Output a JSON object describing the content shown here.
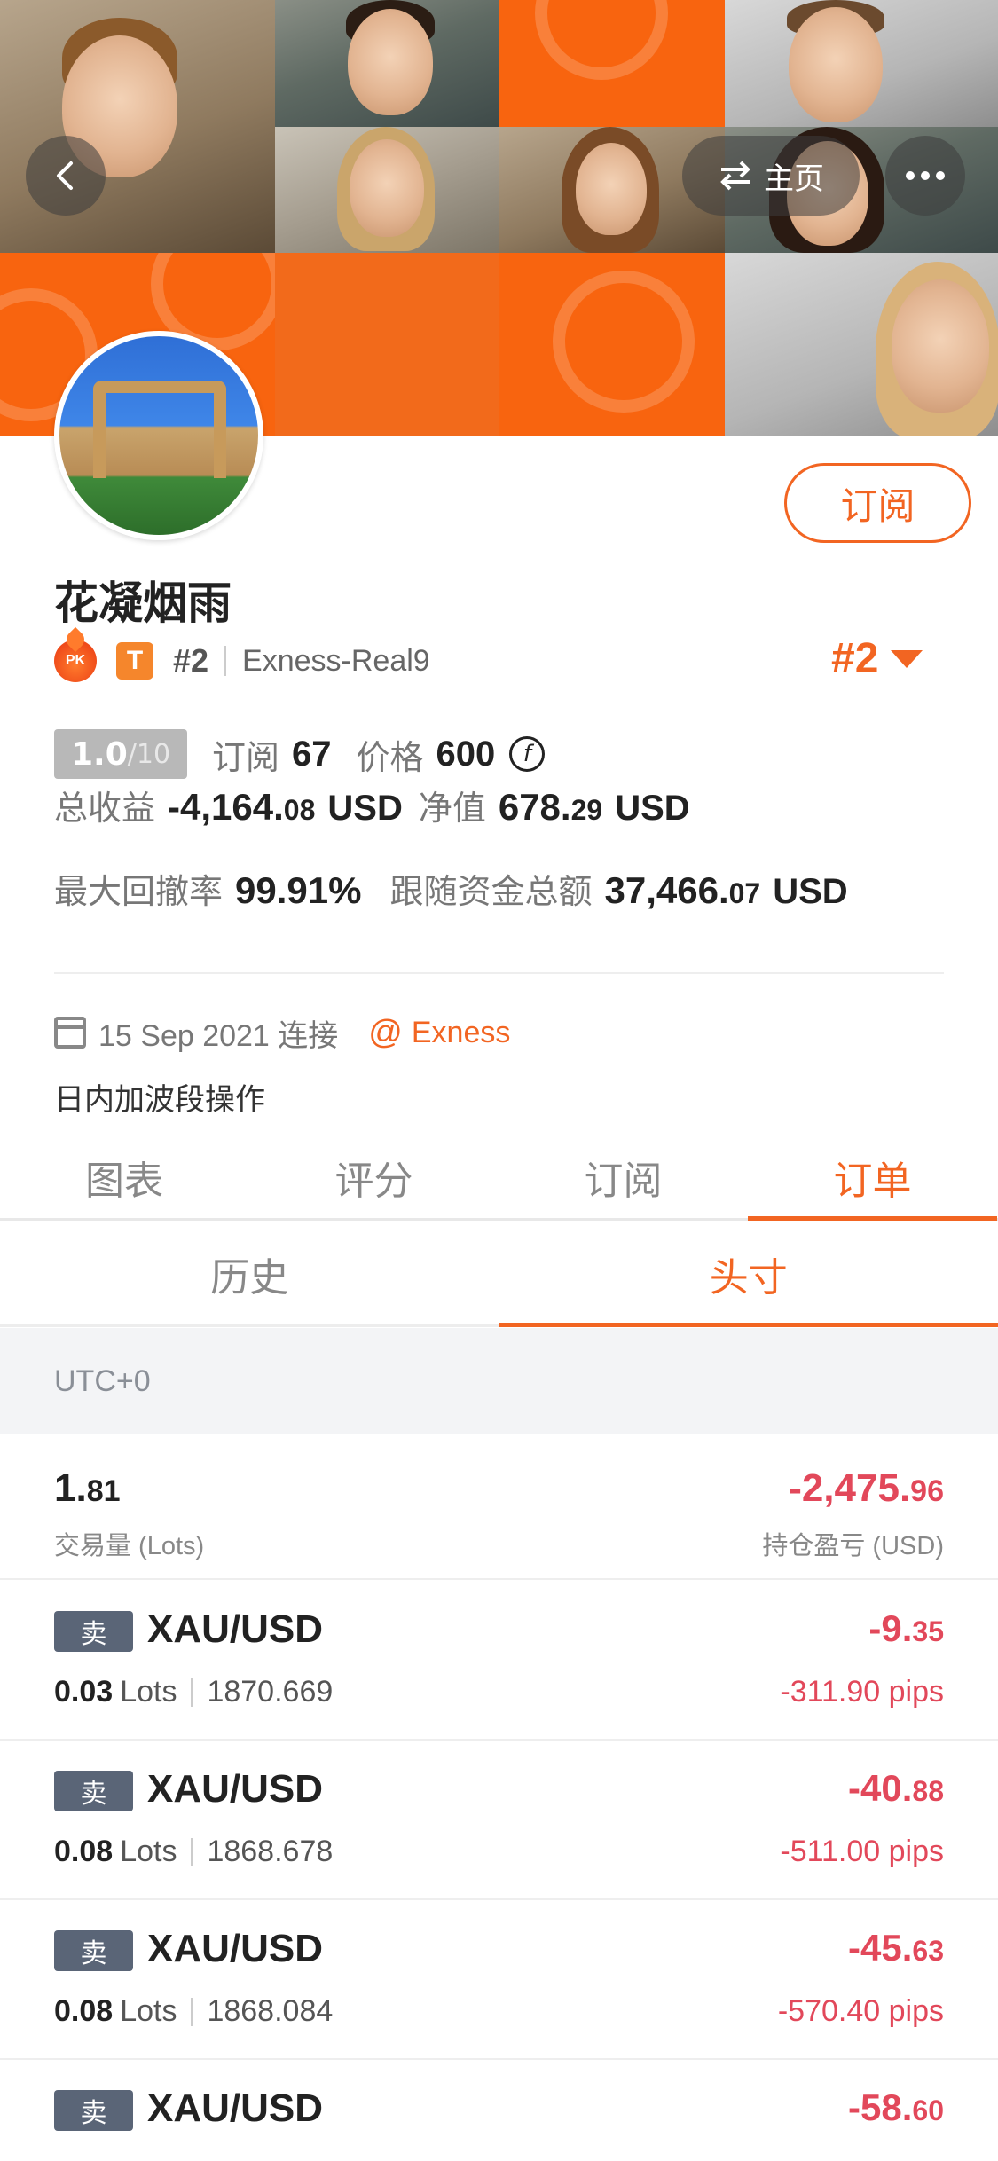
{
  "header": {
    "home_label": "主页"
  },
  "profile": {
    "name": "花凝烟雨",
    "rank_small": "#2",
    "broker": "Exness-Real9",
    "rank_big": "#2",
    "subscribe_label": "订阅",
    "score_main": "1.0",
    "score_den": "/10",
    "subs_label": "订阅",
    "subs_value": "67",
    "price_label": "价格",
    "price_value": "600",
    "total_profit_label": "总收益",
    "total_profit_int": "-4,164.",
    "total_profit_dec": "08",
    "total_profit_unit": "USD",
    "equity_label": "净值",
    "equity_int": "678.",
    "equity_dec": "29",
    "equity_unit": "USD",
    "drawdown_label": "最大回撤率",
    "drawdown_value": "99.91%",
    "follow_label": "跟随资金总额",
    "follow_int": "37,466.",
    "follow_dec": "07",
    "follow_unit": "USD",
    "connect_date": "15 Sep 2021 连接",
    "at": "@",
    "broker_link": "Exness",
    "description": "日内加波段操作"
  },
  "tabs": [
    "图表",
    "评分",
    "订阅",
    "订单"
  ],
  "active_tab": 3,
  "subtabs": [
    "历史",
    "头寸"
  ],
  "active_subtab": 1,
  "timezone": "UTC+0",
  "summary": {
    "volume_int": "1.",
    "volume_dec": "81",
    "volume_label": "交易量 (Lots)",
    "pl_int": "-2,475.",
    "pl_dec": "96",
    "pl_label": "持仓盈亏 (USD)"
  },
  "positions": [
    {
      "side": "卖",
      "symbol": "XAU/USD",
      "lots": "0.03",
      "lots_unit": "Lots",
      "price": "1870.669",
      "pl_int": "-9.",
      "pl_dec": "35",
      "pips": "-311.90 pips"
    },
    {
      "side": "卖",
      "symbol": "XAU/USD",
      "lots": "0.08",
      "lots_unit": "Lots",
      "price": "1868.678",
      "pl_int": "-40.",
      "pl_dec": "88",
      "pips": "-511.00 pips"
    },
    {
      "side": "卖",
      "symbol": "XAU/USD",
      "lots": "0.08",
      "lots_unit": "Lots",
      "price": "1868.084",
      "pl_int": "-45.",
      "pl_dec": "63",
      "pips": "-570.40 pips"
    },
    {
      "side": "卖",
      "symbol": "XAU/USD",
      "lots": "",
      "lots_unit": "",
      "price": "",
      "pl_int": "-58.",
      "pl_dec": "60",
      "pips": ""
    }
  ],
  "colors": {
    "accent": "#f26522",
    "loss": "#e2485a",
    "side_tag": "#5a6577"
  },
  "icons": [
    "back-chevron-icon",
    "swap-icon",
    "more-dots-icon",
    "pk-flame-icon",
    "trader-t-icon",
    "caret-down-icon",
    "coin-icon",
    "calendar-icon"
  ]
}
